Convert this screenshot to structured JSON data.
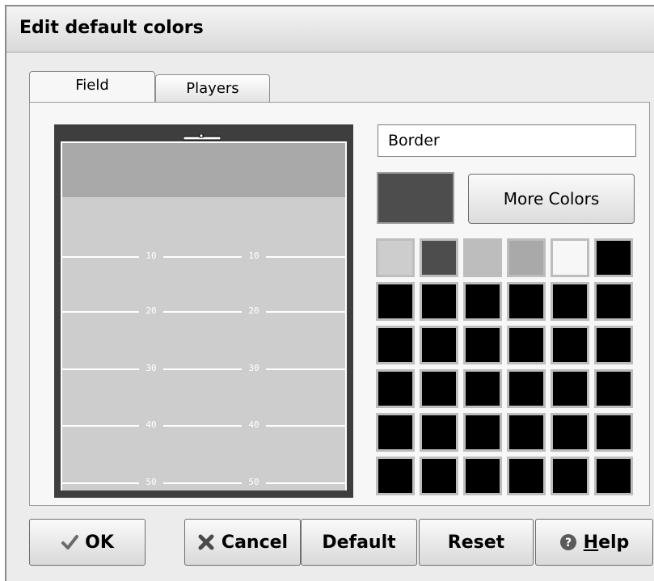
{
  "window": {
    "title": "Edit default colors"
  },
  "tabs": [
    {
      "label": "Field",
      "active": true
    },
    {
      "label": "Players",
      "active": false
    }
  ],
  "field": {
    "border_color": "#3e3e3e",
    "surface_color": "#cdcdcd",
    "endzone_color": "#a9a9a9",
    "yard_numbers": [
      "10",
      "20",
      "30",
      "40",
      "50"
    ]
  },
  "color_editor": {
    "selected_item": "Border",
    "selected_color": "#4d4d4d",
    "more_colors_label": "More Colors",
    "swatches": [
      "#cdcdcd",
      "#4d4d4d",
      "#bdbdbd",
      "#a9a9a9",
      "#f7f7f7",
      "#000000",
      "#000000",
      "#000000",
      "#000000",
      "#000000",
      "#000000",
      "#000000",
      "#000000",
      "#000000",
      "#000000",
      "#000000",
      "#000000",
      "#000000",
      "#000000",
      "#000000",
      "#000000",
      "#000000",
      "#000000",
      "#000000",
      "#000000",
      "#000000",
      "#000000",
      "#000000",
      "#000000",
      "#000000",
      "#000000",
      "#000000",
      "#000000",
      "#000000",
      "#000000",
      "#000000"
    ]
  },
  "buttons": {
    "ok_label": "OK",
    "cancel_label": "Cancel",
    "default_label": "Default",
    "reset_label": "Reset",
    "help_label": "Help",
    "help_hotkey": "H"
  },
  "icons": {
    "ok": "checkmark-icon",
    "cancel": "x-cross-icon",
    "help": "question-circle-icon"
  }
}
